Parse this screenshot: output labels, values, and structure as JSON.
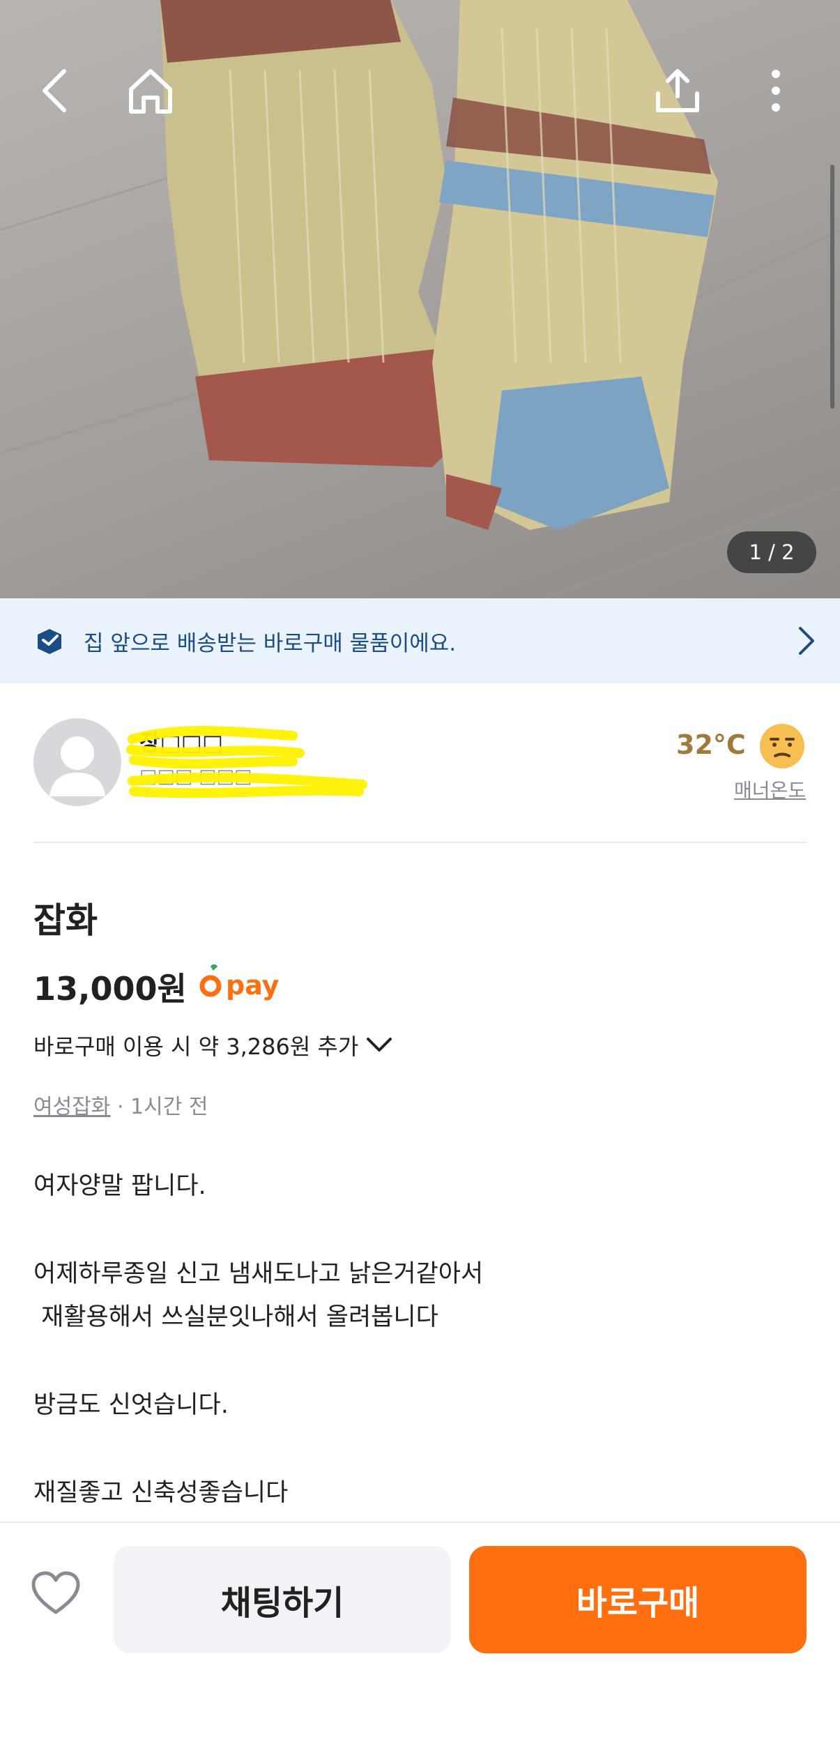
{
  "gallery": {
    "counter": "1 / 2"
  },
  "banner": {
    "text": "집 앞으로 배송받는 바로구매 물품이에요."
  },
  "seller": {
    "name": "장□□□",
    "location": "□□□ □□□",
    "temperature": "32°C",
    "manner_label": "매너온도"
  },
  "product": {
    "title": "잡화",
    "price": "13,000원",
    "pay_label": "pay",
    "extra_fee": "바로구매 이용 시 약 3,286원 추가",
    "category": "여성잡화",
    "time": " · 1시간 전",
    "description": [
      "여자양말 팝니다.",
      "어제하루종일 신고 냄새도나고 낡은거같아서",
      " 재활용해서 쓰실분잇나해서 올려봅니다",
      "방금도 신엇습니다.",
      "재질좋고 신축성좋습니다"
    ]
  },
  "actions": {
    "chat_label": "채팅하기",
    "buy_label": "바로구매"
  },
  "colors": {
    "accent": "#ff6f0f",
    "banner_bg": "#eaf3fc",
    "banner_text": "#1a4c86",
    "temperature": "#a07a3c"
  },
  "icons": [
    "back-icon",
    "home-icon",
    "share-icon",
    "more-icon",
    "delivery-box-icon",
    "chevron-right-icon",
    "avatar-icon",
    "face-icon",
    "carrot-icon",
    "chevron-down-icon",
    "heart-icon"
  ]
}
